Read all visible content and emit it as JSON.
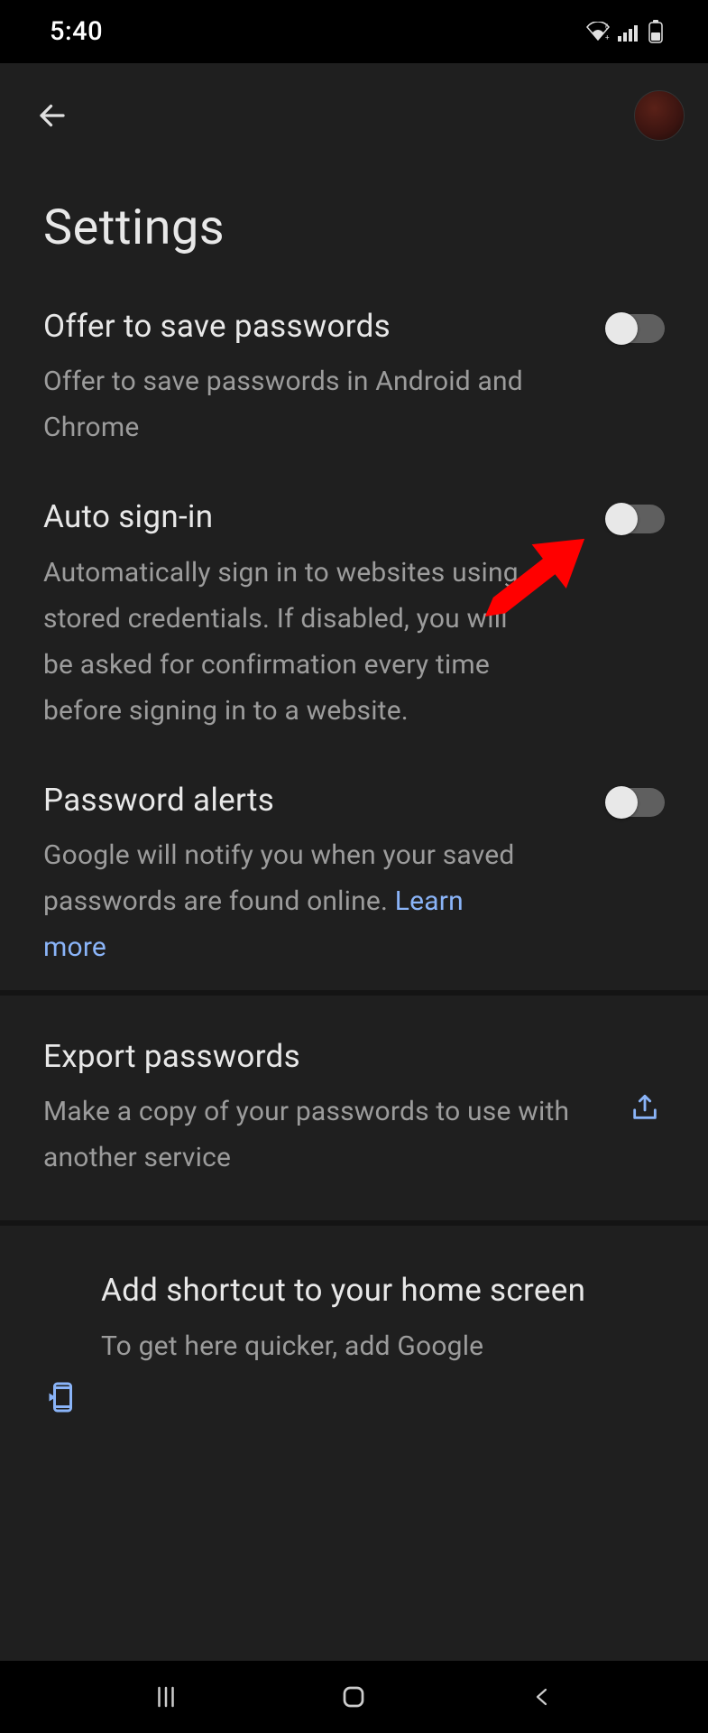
{
  "statusbar": {
    "time": "5:40"
  },
  "page": {
    "title": "Settings"
  },
  "settings": [
    {
      "name": "offer-to-save-passwords",
      "title": "Offer to save passwords",
      "desc": "Offer to save passwords in Android and Chrome",
      "toggle": "off"
    },
    {
      "name": "auto-sign-in",
      "title": "Auto sign-in",
      "desc": "Automatically sign in to websites using stored credentials. If disabled, you will be asked for confirmation every time before signing in to a website.",
      "toggle": "off"
    },
    {
      "name": "password-alerts",
      "title": "Password alerts",
      "desc": "Google will notify you when your saved passwords are found online. ",
      "link_label": "Learn more",
      "toggle": "off"
    }
  ],
  "export": {
    "title": "Export passwords",
    "desc": "Make a copy of your passwords to use with another service"
  },
  "shortcut": {
    "title": "Add shortcut to your home screen",
    "desc": "To get here quicker, add Google"
  },
  "colors": {
    "bg": "#1f1f1f",
    "title": "#e8e8e8",
    "desc": "#9c9c9c",
    "link": "#8ab4f8",
    "toggle_track": "#5f5f5f",
    "annotation_arrow": "#ff0000"
  }
}
